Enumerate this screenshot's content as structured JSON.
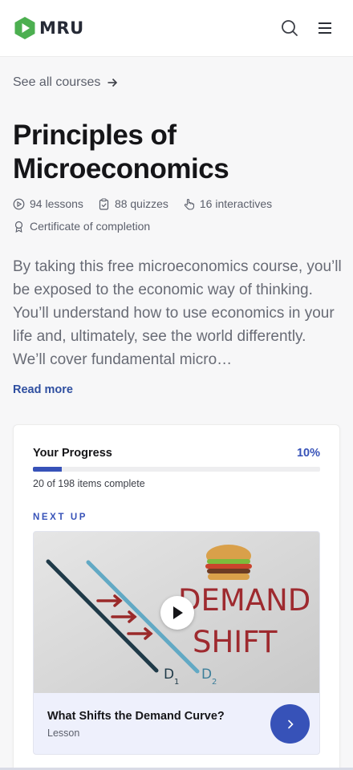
{
  "brand": {
    "name": "MRU",
    "accent": "#3752b8",
    "logo_green": "#4caf50"
  },
  "header": {
    "icons": [
      "search-icon",
      "hamburger-menu-icon"
    ]
  },
  "nav": {
    "back_link": "See all courses"
  },
  "course": {
    "title": "Principles of Microeconomics",
    "stats": {
      "lessons": "94 lessons",
      "quizzes": "88 quizzes",
      "interactives": "16 interactives",
      "certificate": "Certificate of completion"
    },
    "description": "By taking this free microeconomics course, you’ll be exposed to the economic way of thinking. You’ll understand how to use economics in your life and, ultimately, see the world differently. We’ll cover fundamental micro…",
    "read_more": "Read more"
  },
  "progress": {
    "label": "Your Progress",
    "percent_text": "10%",
    "fraction": 0.1,
    "count_text": "20 of 198 items complete"
  },
  "next_up": {
    "heading": "NEXT UP",
    "lesson_title": "What Shifts the Demand Curve?",
    "lesson_type": "Lesson",
    "thumbnail": {
      "text_line1": "DEMAND",
      "text_line2": "SHIFT",
      "curve_label_1": "D",
      "curve_sub_1": "1",
      "curve_label_2": "D",
      "curve_sub_2": "2"
    }
  }
}
